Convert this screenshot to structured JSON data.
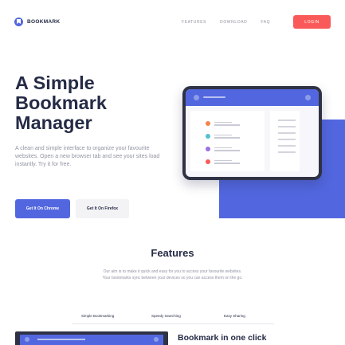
{
  "nav": {
    "logo_text": "BOOKMARK",
    "links": [
      "FEATURES",
      "DOWNLOAD",
      "FAQ"
    ],
    "login_label": "LOGIN"
  },
  "hero": {
    "title": "A Simple Bookmark Manager",
    "description": "A clean and simple interface to organize your favourite websites. Open a new browser tab and see your sites load instantly. Try it for free.",
    "chrome_button": "Get It On Chrome",
    "firefox_button": "Get It On Firefox"
  },
  "bookmark_dots": [
    "#f4844c",
    "#53c0d0",
    "#9b70e0",
    "#fa5959"
  ],
  "features": {
    "title": "Features",
    "description": "Our aim is to make it quick and easy for you to access your favourite websites. Your bookmarks sync between your devices so you can access them on the go.",
    "tabs": [
      "Simple Bookmarking",
      "Speedy Searching",
      "Easy Sharing"
    ],
    "panel_heading": "Bookmark in one click"
  },
  "colors": {
    "accent": "#5267df",
    "danger": "#fa5959",
    "dark": "#252b46",
    "muted": "#9194a2"
  }
}
